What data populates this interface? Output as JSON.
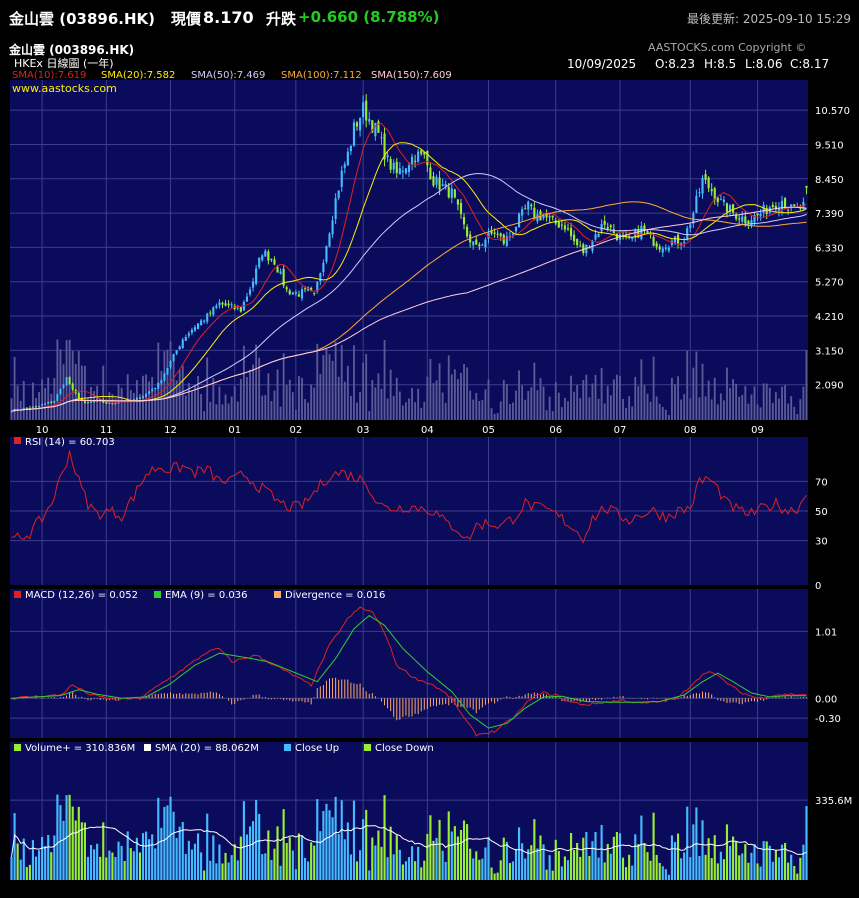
{
  "header": {
    "name_code": "金山雲 (03896.HK)",
    "price_label": "現價",
    "price": "8.170",
    "change_label": "升跌",
    "change": "+0.660 (8.788%)",
    "updated": "最後更新: 2025-09-10 15:29"
  },
  "chart_header": {
    "title": "金山雲 (003896.HK)",
    "subtitle": "HKEx 日線圖 (一年)",
    "copyright": "AASTOCKS.com Copyright ©",
    "site": "www.aastocks.com",
    "ohlc": {
      "date": "10/09/2025",
      "open": "O:8.23",
      "high": "H:8.5",
      "low": "L:8.06",
      "close": "C:8.17"
    }
  },
  "colors": {
    "panel_bg": "#0b0b5c",
    "grid": "#3c3c8c",
    "up_candle": "#44bbff",
    "down_candle": "#99ee33",
    "sma10": "#dd2222",
    "sma20": "#ffee00",
    "sma50": "#ccccff",
    "sma100": "#ffaa33",
    "sma150": "#ffccdd",
    "rsi": "#dd2222",
    "macd": "#dd2222",
    "ema": "#33cc33",
    "divergence": "#ffaa66",
    "volume": "#99ee33",
    "volume_sma": "#ffffff"
  },
  "chart_data": [
    {
      "type": "candlestick",
      "panel": "price",
      "x_ticks": [
        "10",
        "11",
        "12",
        "01",
        "02",
        "03",
        "04",
        "05",
        "06",
        "07",
        "08",
        "09"
      ],
      "y_ticks": [
        "10.570",
        "9.510",
        "8.450",
        "7.390",
        "6.330",
        "5.270",
        "4.210",
        "3.150",
        "2.090"
      ],
      "y_values": [
        10.57,
        9.51,
        8.45,
        7.39,
        6.33,
        5.27,
        4.21,
        3.15,
        2.09
      ],
      "ylim": [
        1.0,
        11.5
      ],
      "legend": [
        "SMA(10):7.619",
        "SMA(20):7.582",
        "SMA(50):7.469",
        "SMA(100):7.112",
        "SMA(150):7.609"
      ],
      "close_anchors": [
        [
          0,
          1.3
        ],
        [
          8,
          1.4
        ],
        [
          14,
          1.6
        ],
        [
          18,
          2.3
        ],
        [
          20,
          1.9
        ],
        [
          24,
          1.5
        ],
        [
          28,
          1.6
        ],
        [
          32,
          1.5
        ],
        [
          36,
          1.6
        ],
        [
          40,
          1.6
        ],
        [
          44,
          1.8
        ],
        [
          48,
          2.1
        ],
        [
          52,
          2.8
        ],
        [
          56,
          3.5
        ],
        [
          60,
          3.9
        ],
        [
          64,
          4.2
        ],
        [
          68,
          4.6
        ],
        [
          71,
          4.5
        ],
        [
          75,
          4.4
        ],
        [
          79,
          5.3
        ],
        [
          82,
          6.2
        ],
        [
          86,
          5.9
        ],
        [
          90,
          5.0
        ],
        [
          94,
          4.9
        ],
        [
          97,
          5.0
        ],
        [
          99,
          4.8
        ],
        [
          102,
          6.0
        ],
        [
          104,
          6.9
        ],
        [
          106,
          7.8
        ],
        [
          108,
          8.6
        ],
        [
          110,
          9.2
        ],
        [
          112,
          10.0
        ],
        [
          115,
          10.6
        ],
        [
          117,
          10.3
        ],
        [
          120,
          9.8
        ],
        [
          123,
          9.0
        ],
        [
          126,
          8.6
        ],
        [
          129,
          8.9
        ],
        [
          132,
          9.2
        ],
        [
          135,
          9.1
        ],
        [
          138,
          8.4
        ],
        [
          141,
          8.2
        ],
        [
          144,
          8.0
        ],
        [
          147,
          7.2
        ],
        [
          149,
          6.7
        ],
        [
          152,
          6.3
        ],
        [
          155,
          6.6
        ],
        [
          158,
          6.8
        ],
        [
          161,
          6.5
        ],
        [
          163,
          6.7
        ],
        [
          166,
          7.2
        ],
        [
          169,
          7.6
        ],
        [
          171,
          7.3
        ],
        [
          174,
          7.3
        ],
        [
          177,
          7.1
        ],
        [
          181,
          7.0
        ],
        [
          184,
          6.5
        ],
        [
          187,
          6.2
        ],
        [
          190,
          6.6
        ],
        [
          194,
          7.1
        ],
        [
          198,
          6.7
        ],
        [
          202,
          6.5
        ],
        [
          206,
          6.9
        ],
        [
          209,
          6.6
        ],
        [
          212,
          6.4
        ],
        [
          216,
          6.5
        ],
        [
          220,
          6.6
        ],
        [
          223,
          7.4
        ],
        [
          226,
          8.4
        ],
        [
          229,
          8.1
        ],
        [
          232,
          7.7
        ],
        [
          236,
          7.4
        ],
        [
          240,
          7.2
        ],
        [
          244,
          7.3
        ],
        [
          248,
          7.6
        ],
        [
          252,
          7.8
        ],
        [
          255,
          7.5
        ],
        [
          257,
          7.5
        ],
        [
          259,
          7.6
        ],
        [
          260,
          8.17
        ]
      ],
      "n_days": 261
    },
    {
      "type": "line",
      "panel": "rsi",
      "legend": [
        "RSI (14)  = 60.703"
      ],
      "y_ticks": [
        "70",
        "50",
        "30",
        "0"
      ],
      "y_values": [
        70,
        50,
        30,
        0
      ],
      "ylim": [
        0,
        100
      ],
      "anchors": [
        [
          0,
          30
        ],
        [
          6,
          35
        ],
        [
          10,
          45
        ],
        [
          13,
          55
        ],
        [
          16,
          72
        ],
        [
          19,
          90
        ],
        [
          22,
          70
        ],
        [
          25,
          55
        ],
        [
          28,
          48
        ],
        [
          32,
          50
        ],
        [
          36,
          47
        ],
        [
          40,
          60
        ],
        [
          44,
          75
        ],
        [
          48,
          80
        ],
        [
          52,
          78
        ],
        [
          56,
          80
        ],
        [
          60,
          76
        ],
        [
          64,
          78
        ],
        [
          68,
          70
        ],
        [
          72,
          70
        ],
        [
          76,
          75
        ],
        [
          80,
          68
        ],
        [
          84,
          62
        ],
        [
          88,
          55
        ],
        [
          92,
          52
        ],
        [
          96,
          55
        ],
        [
          100,
          65
        ],
        [
          104,
          74
        ],
        [
          108,
          76
        ],
        [
          112,
          73
        ],
        [
          116,
          70
        ],
        [
          119,
          58
        ],
        [
          122,
          52
        ],
        [
          126,
          52
        ],
        [
          130,
          53
        ],
        [
          134,
          52
        ],
        [
          138,
          50
        ],
        [
          142,
          42
        ],
        [
          146,
          38
        ],
        [
          149,
          30
        ],
        [
          152,
          40
        ],
        [
          156,
          42
        ],
        [
          160,
          40
        ],
        [
          164,
          45
        ],
        [
          168,
          55
        ],
        [
          172,
          52
        ],
        [
          176,
          50
        ],
        [
          180,
          45
        ],
        [
          184,
          38
        ],
        [
          187,
          32
        ],
        [
          190,
          45
        ],
        [
          194,
          52
        ],
        [
          198,
          48
        ],
        [
          202,
          44
        ],
        [
          206,
          48
        ],
        [
          210,
          50
        ],
        [
          214,
          46
        ],
        [
          218,
          50
        ],
        [
          222,
          52
        ],
        [
          225,
          70
        ],
        [
          228,
          72
        ],
        [
          231,
          65
        ],
        [
          234,
          55
        ],
        [
          238,
          50
        ],
        [
          242,
          48
        ],
        [
          246,
          52
        ],
        [
          250,
          55
        ],
        [
          254,
          50
        ],
        [
          257,
          52
        ],
        [
          260,
          60.7
        ]
      ]
    },
    {
      "type": "line+bar",
      "panel": "macd",
      "legend": [
        "MACD (12,26) = 0.052",
        "EMA (9) = 0.036",
        "Divergence = 0.016"
      ],
      "y_ticks": [
        "1.01",
        "0.00",
        "-0.30"
      ],
      "y_values": [
        1.01,
        0.0,
        -0.3
      ],
      "ylim": [
        -0.6,
        1.65
      ],
      "macd_anchors": [
        [
          0,
          0
        ],
        [
          16,
          0.05
        ],
        [
          20,
          0.2
        ],
        [
          26,
          0.05
        ],
        [
          34,
          -0.02
        ],
        [
          42,
          0
        ],
        [
          50,
          0.25
        ],
        [
          58,
          0.5
        ],
        [
          64,
          0.7
        ],
        [
          68,
          0.75
        ],
        [
          72,
          0.55
        ],
        [
          80,
          0.65
        ],
        [
          86,
          0.5
        ],
        [
          92,
          0.35
        ],
        [
          98,
          0.2
        ],
        [
          104,
          0.8
        ],
        [
          110,
          1.2
        ],
        [
          114,
          1.37
        ],
        [
          118,
          1.3
        ],
        [
          122,
          1.0
        ],
        [
          126,
          0.5
        ],
        [
          132,
          0.3
        ],
        [
          138,
          0.2
        ],
        [
          144,
          0
        ],
        [
          148,
          -0.3
        ],
        [
          152,
          -0.55
        ],
        [
          158,
          -0.5
        ],
        [
          164,
          -0.3
        ],
        [
          170,
          0
        ],
        [
          174,
          0.08
        ],
        [
          178,
          0.05
        ],
        [
          182,
          -0.05
        ],
        [
          188,
          -0.1
        ],
        [
          194,
          -0.06
        ],
        [
          200,
          -0.03
        ],
        [
          206,
          -0.08
        ],
        [
          212,
          -0.05
        ],
        [
          218,
          0
        ],
        [
          224,
          0.28
        ],
        [
          228,
          0.42
        ],
        [
          232,
          0.3
        ],
        [
          238,
          0.1
        ],
        [
          244,
          0
        ],
        [
          250,
          0.05
        ],
        [
          255,
          0.06
        ],
        [
          260,
          0.052
        ]
      ],
      "ema_anchors": [
        [
          0,
          0
        ],
        [
          16,
          0.04
        ],
        [
          22,
          0.13
        ],
        [
          28,
          0.06
        ],
        [
          36,
          0
        ],
        [
          44,
          0.02
        ],
        [
          52,
          0.22
        ],
        [
          60,
          0.5
        ],
        [
          68,
          0.68
        ],
        [
          76,
          0.62
        ],
        [
          84,
          0.55
        ],
        [
          92,
          0.4
        ],
        [
          100,
          0.25
        ],
        [
          106,
          0.6
        ],
        [
          112,
          1.05
        ],
        [
          117,
          1.25
        ],
        [
          122,
          1.1
        ],
        [
          128,
          0.75
        ],
        [
          136,
          0.4
        ],
        [
          144,
          0.1
        ],
        [
          150,
          -0.25
        ],
        [
          156,
          -0.45
        ],
        [
          162,
          -0.38
        ],
        [
          168,
          -0.15
        ],
        [
          174,
          0.02
        ],
        [
          180,
          0.03
        ],
        [
          188,
          -0.05
        ],
        [
          196,
          -0.06
        ],
        [
          204,
          -0.06
        ],
        [
          212,
          -0.05
        ],
        [
          220,
          0.05
        ],
        [
          226,
          0.25
        ],
        [
          231,
          0.38
        ],
        [
          236,
          0.25
        ],
        [
          242,
          0.08
        ],
        [
          248,
          0.02
        ],
        [
          254,
          0.04
        ],
        [
          260,
          0.036
        ]
      ]
    },
    {
      "type": "bar",
      "panel": "volume",
      "legend": [
        "Volume+  = 310.836M",
        "SMA (20)  = 88.062M",
        "Close Up",
        "Close Down"
      ],
      "y_ticks": [
        "335.6M"
      ],
      "y_values": [
        335.6
      ],
      "ylim": [
        0,
        580
      ],
      "last_volume": 310.836,
      "last_sma": 88.062
    }
  ]
}
